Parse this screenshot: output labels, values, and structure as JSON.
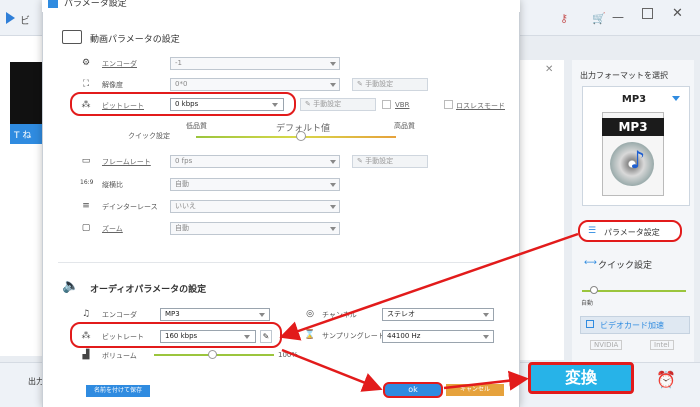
{
  "app": {
    "name": "ビ",
    "thumb_text": "T ね"
  },
  "dialog": {
    "title": "パラメータ設定"
  },
  "video": {
    "section_title": "動画パラメータの設定",
    "rows": [
      {
        "label": "エンコーダ",
        "value": "-1"
      },
      {
        "label": "解像度",
        "value": "0*0",
        "manual": "手動設定"
      },
      {
        "label": "ビットレート",
        "value": "0 kbps",
        "manual": "手動設定",
        "vbr": "VBR",
        "lossless": "ロスレスモード"
      },
      {
        "label": "フレームレート",
        "value": "0 fps",
        "manual": "手動設定"
      },
      {
        "label": "縦横比",
        "value": "自動"
      },
      {
        "label": "デインターレース",
        "value": "いいえ"
      },
      {
        "label": "ズーム",
        "value": "自動"
      }
    ],
    "quick_label": "クイック設定",
    "quality_low": "低品質",
    "quality_default": "デフォルト値",
    "quality_high": "高品質",
    "quality_level": 0.5
  },
  "audio": {
    "section_title": "オーディオパラメータの設定",
    "encoder_label": "エンコーダ",
    "encoder_value": "MP3",
    "bitrate_label": "ビットレート",
    "bitrate_value": "160 kbps",
    "volume_label": "ボリューム",
    "volume_value": "100%",
    "volume_level": 0.5,
    "channel_label": "チャンネル",
    "channel_value": "ステレオ",
    "samplerate_label": "サンプリングレート",
    "samplerate_value": "44100 Hz"
  },
  "buttons": {
    "save": "名前を付けて保存",
    "ok": "ok",
    "cancel": "キャンセル",
    "convert": "変換"
  },
  "right_panel": {
    "format_label": "出力フォーマットを選択",
    "format": "MP3",
    "param_button": "パラメータ設定",
    "quick_setting": "クイック設定",
    "auto": "自動",
    "gpu": "ビデオカード加速",
    "nvidia": "NVIDIA",
    "intel": "Intel"
  },
  "bottom": {
    "output_label": "出力"
  },
  "colors": {
    "accent": "#2f8be0",
    "highlight": "#e21b1b",
    "convert": "#27b3e8"
  }
}
